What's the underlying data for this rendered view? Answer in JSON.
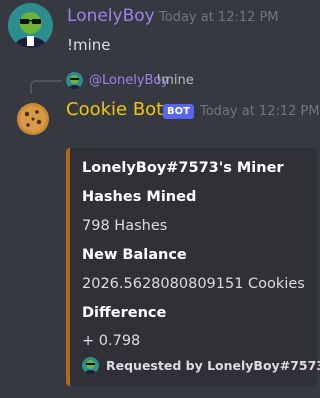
{
  "message1": {
    "username": "LonelyBoy",
    "timestamp": "Today at 12:12 PM",
    "content": "!mine",
    "username_color": "#9b84ee"
  },
  "reply_preview": {
    "username": "@LonelyBoy",
    "content": "!mine"
  },
  "message2": {
    "username": "Cookie Bot",
    "badge": "BOT",
    "timestamp": "Today at 12:12 PM",
    "username_color": "#f1c40f"
  },
  "embed": {
    "title": "LonelyBoy#7573's Miner",
    "fields": [
      {
        "name": "Hashes Mined",
        "value": "798 Hashes"
      },
      {
        "name": "New Balance",
        "value": "2026.5628080809151 Cookies"
      },
      {
        "name": "Difference",
        "value": "+ 0.798"
      }
    ],
    "footer": "Requested by LonelyBoy#7573",
    "accent_color": "#b5651d"
  }
}
